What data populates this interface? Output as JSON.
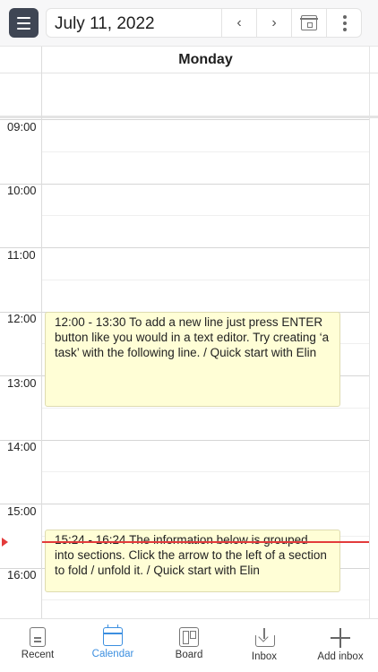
{
  "header": {
    "date": "July 11, 2022",
    "prev_icon": "chevron-left-icon",
    "next_icon": "chevron-right-icon",
    "today_icon": "calendar-icon",
    "more_icon": "more-vertical-icon",
    "prev_glyph": "‹",
    "next_glyph": "›"
  },
  "day": {
    "name": "Monday"
  },
  "hours": [
    "09:00",
    "10:00",
    "11:00",
    "12:00",
    "13:00",
    "14:00",
    "15:00",
    "16:00"
  ],
  "events": [
    {
      "time": "12:00 - 13:30",
      "text": "To add a new line just press ENTER button like you would in a text editor. Try creating ‘a task’ with the following line. / Quick start with Elin",
      "full": "12:00 - 13:30 To add a new line just press ENTER button like you would in a text editor. Try creating ‘a task’ with the following line. / Quick start with Elin"
    },
    {
      "time": "15:24 - 16:24",
      "text": "The information below is grouped into sections. Click the arrow to the left of a section to fold / unfold it. / Quick start with Elin",
      "full": "15:24 - 16:24 The information below is grouped into sections. Click the arrow to the left of a section to fold / unfold it. / Quick start with Elin"
    }
  ],
  "colors": {
    "accent": "#3c8fe0",
    "event_bg": "#fffed6",
    "now_line": "#e33b3b",
    "menu_bg": "#3f4654"
  },
  "bottom_nav": [
    {
      "label": "Recent",
      "icon": "document-icon",
      "active": false
    },
    {
      "label": "Calendar",
      "icon": "calendar-icon",
      "active": true
    },
    {
      "label": "Board",
      "icon": "board-icon",
      "active": false
    },
    {
      "label": "Inbox",
      "icon": "inbox-icon",
      "active": false
    },
    {
      "label": "Add inbox",
      "icon": "plus-icon",
      "active": false
    }
  ]
}
